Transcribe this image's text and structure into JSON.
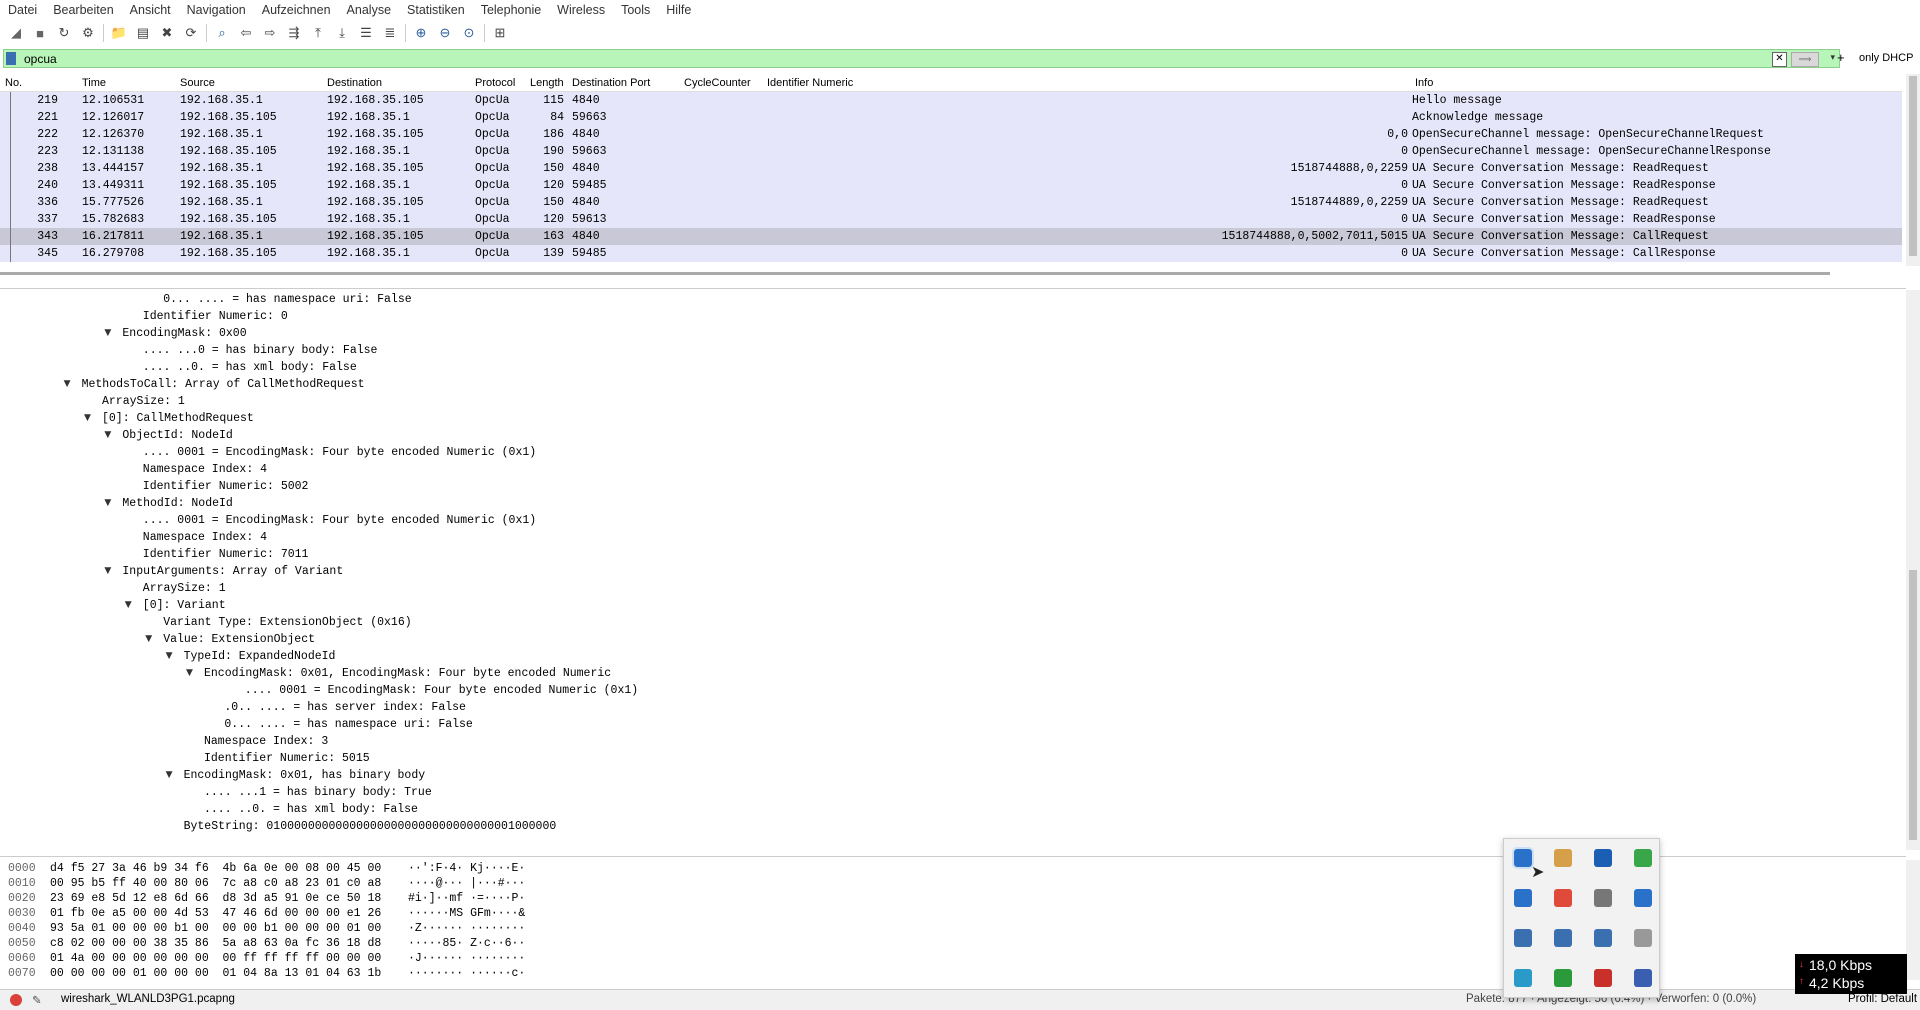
{
  "menu": [
    "Datei",
    "Bearbeiten",
    "Ansicht",
    "Navigation",
    "Aufzeichnen",
    "Analyse",
    "Statistiken",
    "Telephonie",
    "Wireless",
    "Tools",
    "Hilfe"
  ],
  "toolbar_icons": [
    "shark-fin-start-icon",
    "stop-icon",
    "restart-icon",
    "options-gear-icon",
    "open-folder-icon",
    "save-icon",
    "close-file-icon",
    "reload-icon",
    "find-icon",
    "back-arrow-icon",
    "forward-arrow-icon",
    "go-to-packet-icon",
    "first-packet-icon",
    "last-packet-icon",
    "autoscroll-icon",
    "colorize-icon",
    "zoom-in-icon",
    "zoom-out-icon",
    "zoom-normal-icon",
    "resize-columns-icon"
  ],
  "filter": {
    "value": "opcua",
    "only_dhcp": "only DHCP"
  },
  "columns": {
    "no": "No.",
    "time": "Time",
    "source": "Source",
    "destination": "Destination",
    "protocol": "Protocol",
    "length": "Length",
    "dest_port": "Destination Port",
    "cycle": "CycleCounter",
    "idnum": "Identifier Numeric",
    "info": "Info"
  },
  "packets": [
    {
      "no": "219",
      "time": "12.106531",
      "src": "192.168.35.1",
      "dst": "192.168.35.105",
      "proto": "OpcUa",
      "len": "115",
      "port": "4840",
      "idn": "",
      "info": "Hello message"
    },
    {
      "no": "221",
      "time": "12.126017",
      "src": "192.168.35.105",
      "dst": "192.168.35.1",
      "proto": "OpcUa",
      "len": "84",
      "port": "59663",
      "idn": "",
      "info": "Acknowledge message"
    },
    {
      "no": "222",
      "time": "12.126370",
      "src": "192.168.35.1",
      "dst": "192.168.35.105",
      "proto": "OpcUa",
      "len": "186",
      "port": "4840",
      "idn": "0,0",
      "info": "OpenSecureChannel message: OpenSecureChannelRequest"
    },
    {
      "no": "223",
      "time": "12.131138",
      "src": "192.168.35.105",
      "dst": "192.168.35.1",
      "proto": "OpcUa",
      "len": "190",
      "port": "59663",
      "idn": "0",
      "info": "OpenSecureChannel message: OpenSecureChannelResponse"
    },
    {
      "no": "238",
      "time": "13.444157",
      "src": "192.168.35.1",
      "dst": "192.168.35.105",
      "proto": "OpcUa",
      "len": "150",
      "port": "4840",
      "idn": "1518744888,0,2259",
      "info": "UA Secure Conversation Message: ReadRequest"
    },
    {
      "no": "240",
      "time": "13.449311",
      "src": "192.168.35.105",
      "dst": "192.168.35.1",
      "proto": "OpcUa",
      "len": "120",
      "port": "59485",
      "idn": "0",
      "info": "UA Secure Conversation Message: ReadResponse"
    },
    {
      "no": "336",
      "time": "15.777526",
      "src": "192.168.35.1",
      "dst": "192.168.35.105",
      "proto": "OpcUa",
      "len": "150",
      "port": "4840",
      "idn": "1518744889,0,2259",
      "info": "UA Secure Conversation Message: ReadRequest"
    },
    {
      "no": "337",
      "time": "15.782683",
      "src": "192.168.35.105",
      "dst": "192.168.35.1",
      "proto": "OpcUa",
      "len": "120",
      "port": "59613",
      "idn": "0",
      "info": "UA Secure Conversation Message: ReadResponse"
    },
    {
      "no": "343",
      "time": "16.217811",
      "src": "192.168.35.1",
      "dst": "192.168.35.105",
      "proto": "OpcUa",
      "len": "163",
      "port": "4840",
      "idn": "1518744888,0,5002,7011,5015",
      "info": "UA Secure Conversation Message: CallRequest",
      "selected": true
    },
    {
      "no": "345",
      "time": "16.279708",
      "src": "192.168.35.105",
      "dst": "192.168.35.1",
      "proto": "OpcUa",
      "len": "139",
      "port": "59485",
      "idn": "0",
      "info": "UA Secure Conversation Message: CallResponse"
    }
  ],
  "details": [
    {
      "indent": 8,
      "exp": "",
      "text": "0... .... = has namespace uri: False"
    },
    {
      "indent": 7,
      "exp": "",
      "text": "Identifier Numeric: 0"
    },
    {
      "indent": 6,
      "exp": "open",
      "text": "EncodingMask: 0x00"
    },
    {
      "indent": 7,
      "exp": "",
      "text": ".... ...0 = has binary body: False"
    },
    {
      "indent": 7,
      "exp": "",
      "text": ".... ..0. = has xml body: False"
    },
    {
      "indent": 4,
      "exp": "open",
      "text": "MethodsToCall: Array of CallMethodRequest"
    },
    {
      "indent": 5,
      "exp": "",
      "text": "ArraySize: 1"
    },
    {
      "indent": 5,
      "exp": "open",
      "text": "[0]: CallMethodRequest"
    },
    {
      "indent": 6,
      "exp": "open",
      "text": "ObjectId: NodeId"
    },
    {
      "indent": 7,
      "exp": "",
      "text": ".... 0001 = EncodingMask: Four byte encoded Numeric (0x1)"
    },
    {
      "indent": 7,
      "exp": "",
      "text": "Namespace Index: 4"
    },
    {
      "indent": 7,
      "exp": "",
      "text": "Identifier Numeric: 5002"
    },
    {
      "indent": 6,
      "exp": "open",
      "text": "MethodId: NodeId"
    },
    {
      "indent": 7,
      "exp": "",
      "text": ".... 0001 = EncodingMask: Four byte encoded Numeric (0x1)"
    },
    {
      "indent": 7,
      "exp": "",
      "text": "Namespace Index: 4"
    },
    {
      "indent": 7,
      "exp": "",
      "text": "Identifier Numeric: 7011"
    },
    {
      "indent": 6,
      "exp": "open",
      "text": "InputArguments: Array of Variant"
    },
    {
      "indent": 7,
      "exp": "",
      "text": "ArraySize: 1"
    },
    {
      "indent": 7,
      "exp": "open",
      "text": "[0]: Variant"
    },
    {
      "indent": 8,
      "exp": "",
      "text": "Variant Type: ExtensionObject (0x16)"
    },
    {
      "indent": 8,
      "exp": "open",
      "text": "Value: ExtensionObject"
    },
    {
      "indent": 9,
      "exp": "open",
      "text": "TypeId: ExpandedNodeId"
    },
    {
      "indent": 10,
      "exp": "open",
      "text": "EncodingMask: 0x01, EncodingMask: Four byte encoded Numeric"
    },
    {
      "indent": 12,
      "exp": "",
      "text": ".... 0001 = EncodingMask: Four byte encoded Numeric (0x1)"
    },
    {
      "indent": 11,
      "exp": "",
      "text": ".0.. .... = has server index: False"
    },
    {
      "indent": 11,
      "exp": "",
      "text": "0... .... = has namespace uri: False"
    },
    {
      "indent": 10,
      "exp": "",
      "text": "Namespace Index: 3"
    },
    {
      "indent": 10,
      "exp": "",
      "text": "Identifier Numeric: 5015"
    },
    {
      "indent": 9,
      "exp": "open",
      "text": "EncodingMask: 0x01, has binary body"
    },
    {
      "indent": 10,
      "exp": "",
      "text": ".... ...1 = has binary body: True"
    },
    {
      "indent": 10,
      "exp": "",
      "text": ".... ..0. = has xml body: False"
    },
    {
      "indent": 9,
      "exp": "",
      "text": "ByteString: 010000000000000000000000000000000001000000"
    }
  ],
  "hex": [
    {
      "off": "0000",
      "bytes": "d4 f5 27 3a 46 b9 34 f6  4b 6a 0e 00 08 00 45 00",
      "ascii": "··':F·4· Kj····E·"
    },
    {
      "off": "0010",
      "bytes": "00 95 b5 ff 40 00 80 06  7c a8 c0 a8 23 01 c0 a8",
      "ascii": "····@··· |···#···"
    },
    {
      "off": "0020",
      "bytes": "23 69 e8 5d 12 e8 6d 66  d8 3d a5 91 0e ce 50 18",
      "ascii": "#i·]··mf ·=····P·"
    },
    {
      "off": "0030",
      "bytes": "01 fb 0e a5 00 00 4d 53  47 46 6d 00 00 00 e1 26",
      "ascii": "······MS GFm····&"
    },
    {
      "off": "0040",
      "bytes": "93 5a 01 00 00 00 b1 00  00 00 b1 00 00 00 01 00",
      "ascii": "·Z······ ········"
    },
    {
      "off": "0050",
      "bytes": "c8 02 00 00 00 38 35 86  5a a8 63 0a fc 36 18 d8",
      "ascii": "·····85· Z·c··6··"
    },
    {
      "off": "0060",
      "bytes": "01 4a 00 00 00 00 00 00  00 ff ff ff ff 00 00 00",
      "ascii": "·J······ ········"
    },
    {
      "off": "0070",
      "bytes": "00 00 00 00 01 00 00 00  01 04 8a 13 01 04 63 1b",
      "ascii": "········ ······c·"
    }
  ],
  "status": {
    "file": "wireshark_WLANLD3PG1.pcapng",
    "packets": "Pakete: 877 · Angezeigt: 56 (6.4%) · Verworfen: 0 (0.0%)",
    "profile": "Profil: Default"
  },
  "tray_icons": [
    "capture-tool-icon",
    "mail-icon",
    "outlook-icon",
    "wechat-icon",
    "tool-icon",
    "chrome-icon",
    "usb-device-icon",
    "teams-chat-icon",
    "graphics-icon",
    "network-icon",
    "sds-icon",
    "disc-icon",
    "search-app-icon",
    "sync-icon",
    "antivirus-icon",
    "teams-icon"
  ],
  "network": {
    "down": "18,0 Kbps",
    "up": "4,2 Kbps"
  },
  "colors": {
    "row_bg": "#e6e6fa",
    "row_selected": "#c8c8d6",
    "filter_bg": "#b8f5b8"
  }
}
